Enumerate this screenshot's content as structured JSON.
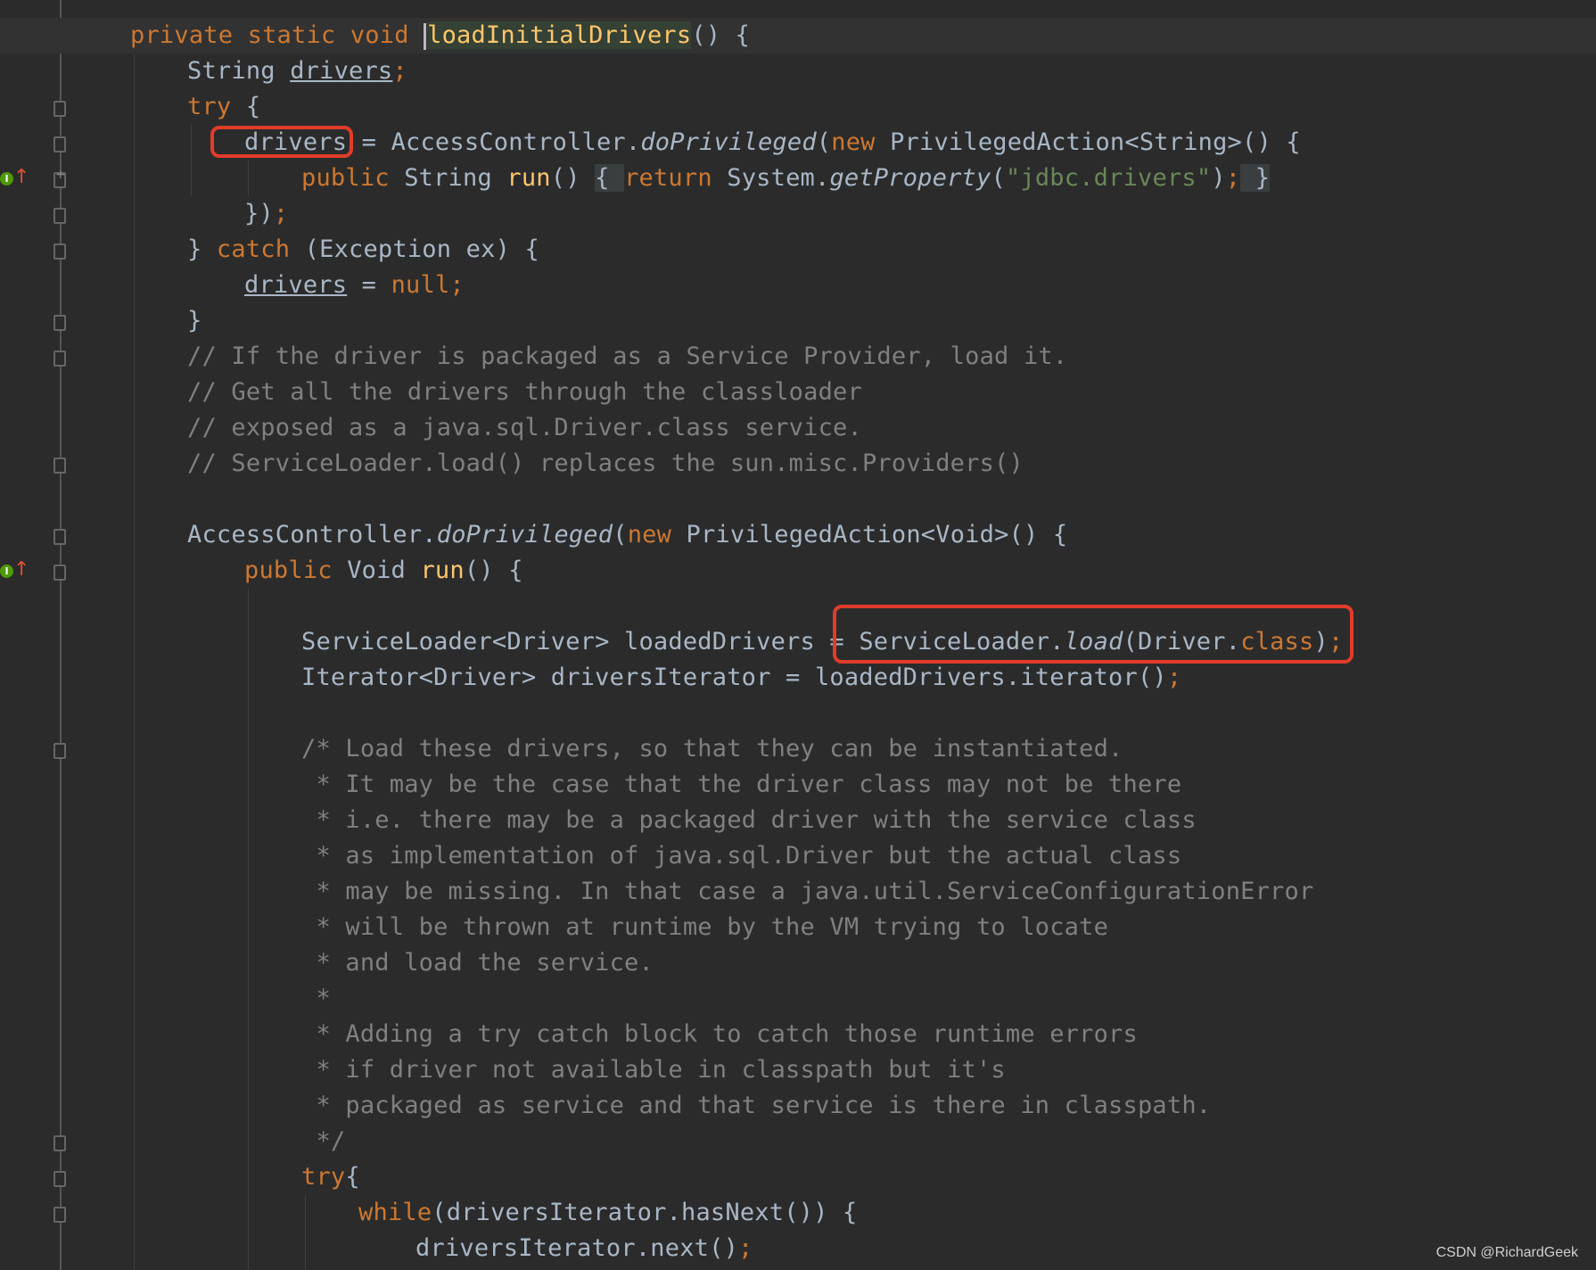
{
  "lines": {
    "l1": {
      "kw": "private static void ",
      "fn": "loadInitialDrivers",
      "rest": "() {"
    },
    "l2": {
      "type": "String ",
      "var": "drivers",
      "semi": ";"
    },
    "l3": {
      "kw": "try",
      "rest": " {"
    },
    "l4": {
      "var": "drivers",
      "a": " = AccessController.",
      "m": "doPrivileged",
      "b": "(",
      "kw": "new",
      "c": " PrivilegedAction<String>() {"
    },
    "l5": {
      "kw1": "public",
      "a": " String ",
      "fn": "run",
      "b": "() ",
      "br1": "{ ",
      "kw2": "return",
      "c": " System.",
      "m": "getProperty",
      "d": "(",
      "str": "\"jdbc.drivers\"",
      "e": ")",
      "semi": ";",
      "br2": " }"
    },
    "l6": {
      "a": "})",
      "semi": ";"
    },
    "l7": {
      "a": "} ",
      "kw": "catch",
      "b": " (Exception ex) {"
    },
    "l8": {
      "var": "drivers",
      "a": " = ",
      "kw": "null",
      "semi": ";"
    },
    "l9": {
      "a": "}"
    },
    "l10": {
      "cm": "// If the driver is packaged as a Service Provider, load it."
    },
    "l11": {
      "cm": "// Get all the drivers through the classloader"
    },
    "l12": {
      "cm": "// exposed as a java.sql.Driver.class service."
    },
    "l13": {
      "cm": "// ServiceLoader.load() replaces the sun.misc.Providers()"
    },
    "l14": {
      "a": "AccessController.",
      "m": "doPrivileged",
      "b": "(",
      "kw": "new",
      "c": " PrivilegedAction<Void>() {"
    },
    "l15": {
      "kw": "public",
      "a": " Void ",
      "fn": "run",
      "b": "() {"
    },
    "l16": {
      "a": "ServiceLoader<Driver> loadedDrivers = ",
      "b": "ServiceLoader.",
      "m": "load",
      "c": "(Driver.",
      "kw": "class",
      "d": ")",
      "semi": ";"
    },
    "l17": {
      "a": "Iterator<Driver> driversIterator = loadedDrivers.iterator()",
      "semi": ";"
    },
    "l18": {
      "cm": "/* Load these drivers, so that they can be instantiated."
    },
    "l19": {
      "cm": " * It may be the case that the driver class may not be there"
    },
    "l20": {
      "cm": " * i.e. there may be a packaged driver with the service class"
    },
    "l21": {
      "cm": " * as implementation of java.sql.Driver but the actual class"
    },
    "l22": {
      "cm": " * may be missing. In that case a java.util.ServiceConfigurationError"
    },
    "l23": {
      "cm": " * will be thrown at runtime by the VM trying to locate"
    },
    "l24": {
      "cm": " * and load the service."
    },
    "l25": {
      "cm": " *"
    },
    "l26": {
      "cm": " * Adding a try catch block to catch those runtime errors"
    },
    "l27": {
      "cm": " * if driver not available in classpath but it's"
    },
    "l28": {
      "cm": " * packaged as service and that service is there in classpath."
    },
    "l29": {
      "cm": " */"
    },
    "l30": {
      "kw": "try",
      "a": "{"
    },
    "l31": {
      "kw": "while",
      "a": "(driversIterator.hasNext()) {"
    },
    "l32": {
      "a": "driversIterator.next()",
      "semi": ";"
    }
  },
  "gutter_markers": {
    "impl_letter": "I"
  },
  "watermark": "CSDN @RichardGeek",
  "colors": {
    "background": "#2b2b2b",
    "keyword": "#cc7832",
    "method": "#ffc66d",
    "string": "#6a8759",
    "comment": "#808080",
    "text": "#a9b7c6",
    "highlight_box": "#e03c2a"
  }
}
